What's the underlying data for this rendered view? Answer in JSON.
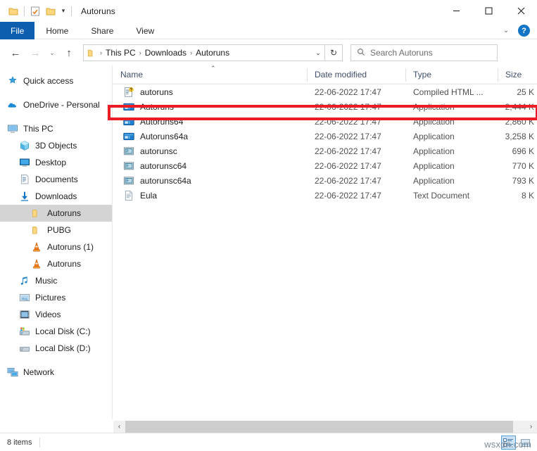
{
  "window": {
    "title": "Autoruns",
    "quick_access": [
      {
        "name": "folder-icon",
        "label": "Folder"
      },
      {
        "name": "properties-icon",
        "label": "Properties"
      },
      {
        "name": "new-folder-icon",
        "label": "New folder"
      },
      {
        "name": "customize-caret-icon",
        "label": "Customize Quick Access Toolbar"
      }
    ],
    "controls": {
      "minimize": "Minimize",
      "maximize": "Maximize",
      "close": "Close"
    }
  },
  "ribbon": {
    "tabs": [
      {
        "label": "File",
        "active": true
      },
      {
        "label": "Home",
        "active": false
      },
      {
        "label": "Share",
        "active": false
      },
      {
        "label": "View",
        "active": false
      }
    ],
    "collapse_label": "Minimize the Ribbon",
    "help_label": "?"
  },
  "address": {
    "back_label": "Back",
    "forward_label": "Forward",
    "recent_label": "Recent locations",
    "up_label": "Up",
    "breadcrumbs": [
      "This PC",
      "Downloads",
      "Autoruns"
    ],
    "separator": "›",
    "dropdown_label": "Previous locations",
    "refresh_label": "Refresh"
  },
  "search": {
    "placeholder": "Search Autoruns",
    "value": "",
    "icon": "search-icon"
  },
  "sidebar": {
    "items": [
      {
        "label": "Quick access",
        "icon": "star-pin-icon",
        "indent": 0,
        "selected": false,
        "gap_after": true
      },
      {
        "label": "OneDrive - Personal",
        "icon": "cloud-icon",
        "indent": 0,
        "selected": false,
        "gap_after": true
      },
      {
        "label": "This PC",
        "icon": "computer-icon",
        "indent": 0,
        "selected": false
      },
      {
        "label": "3D Objects",
        "icon": "3d-objects-icon",
        "indent": 1,
        "selected": false
      },
      {
        "label": "Desktop",
        "icon": "desktop-icon",
        "indent": 1,
        "selected": false
      },
      {
        "label": "Documents",
        "icon": "documents-icon",
        "indent": 1,
        "selected": false
      },
      {
        "label": "Downloads",
        "icon": "downloads-icon",
        "indent": 1,
        "selected": false
      },
      {
        "label": "Autoruns",
        "icon": "folder-icon",
        "indent": 2,
        "selected": true
      },
      {
        "label": "PUBG",
        "icon": "folder-icon",
        "indent": 2,
        "selected": false
      },
      {
        "label": "Autoruns (1)",
        "icon": "vlc-cone-icon",
        "indent": 2,
        "selected": false
      },
      {
        "label": "Autoruns",
        "icon": "vlc-cone-icon",
        "indent": 2,
        "selected": false
      },
      {
        "label": "Music",
        "icon": "music-icon",
        "indent": 1,
        "selected": false
      },
      {
        "label": "Pictures",
        "icon": "pictures-icon",
        "indent": 1,
        "selected": false
      },
      {
        "label": "Videos",
        "icon": "videos-icon",
        "indent": 1,
        "selected": false
      },
      {
        "label": "Local Disk (C:)",
        "icon": "system-drive-icon",
        "indent": 1,
        "selected": false
      },
      {
        "label": "Local Disk (D:)",
        "icon": "drive-icon",
        "indent": 1,
        "selected": false,
        "gap_after": true
      },
      {
        "label": "Network",
        "icon": "network-icon",
        "indent": 0,
        "selected": false
      }
    ]
  },
  "file_list": {
    "columns": [
      {
        "label": "Name",
        "sorted": "asc"
      },
      {
        "label": "Date modified",
        "sorted": null
      },
      {
        "label": "Type",
        "sorted": null
      },
      {
        "label": "Size",
        "sorted": null
      }
    ],
    "rows": [
      {
        "name": "autoruns",
        "date": "22-06-2022 17:47",
        "type": "Compiled HTML ...",
        "size": "25 K",
        "icon": "chm-help-icon",
        "highlighted": false
      },
      {
        "name": "Autoruns",
        "date": "22-06-2022 17:47",
        "type": "Application",
        "size": "2,444 K",
        "icon": "application-icon",
        "highlighted": true
      },
      {
        "name": "Autoruns64",
        "date": "22-06-2022 17:47",
        "type": "Application",
        "size": "2,860 K",
        "icon": "application-icon",
        "highlighted": false
      },
      {
        "name": "Autoruns64a",
        "date": "22-06-2022 17:47",
        "type": "Application",
        "size": "3,258 K",
        "icon": "application-icon",
        "highlighted": false
      },
      {
        "name": "autorunsc",
        "date": "22-06-2022 17:47",
        "type": "Application",
        "size": "696 K",
        "icon": "console-app-icon",
        "highlighted": false
      },
      {
        "name": "autorunsc64",
        "date": "22-06-2022 17:47",
        "type": "Application",
        "size": "770 K",
        "icon": "console-app-icon",
        "highlighted": false
      },
      {
        "name": "autorunsc64a",
        "date": "22-06-2022 17:47",
        "type": "Application",
        "size": "793 K",
        "icon": "console-app-icon",
        "highlighted": false
      },
      {
        "name": "Eula",
        "date": "22-06-2022 17:47",
        "type": "Text Document",
        "size": "8 K",
        "icon": "text-document-icon",
        "highlighted": false
      }
    ]
  },
  "annotation": {
    "color": "#ec1c24",
    "target_row": "Autoruns"
  },
  "scrollbar": {
    "left_arrow": "‹",
    "right_arrow": "›"
  },
  "status": {
    "item_count": "8 items",
    "views": [
      {
        "name": "details-view-button",
        "label": "Details view",
        "active": true
      },
      {
        "name": "large-icons-view-button",
        "label": "Large icons view",
        "active": false
      }
    ]
  },
  "watermark": {
    "text": "wsxdn.com"
  }
}
